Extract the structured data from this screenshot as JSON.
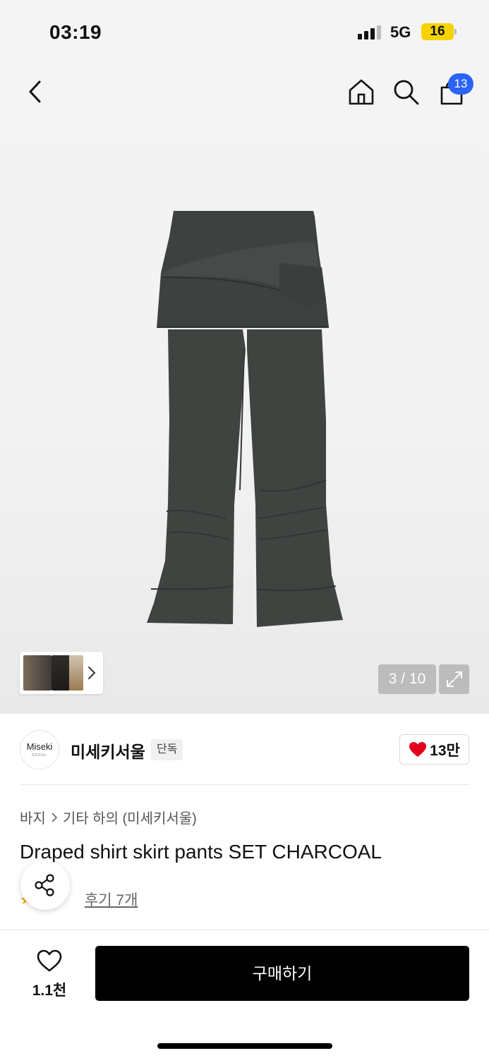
{
  "status_bar": {
    "time": "03:19",
    "network": "5G",
    "battery": "16"
  },
  "nav": {
    "cart_count": "13"
  },
  "gallery": {
    "counter": "3 / 10"
  },
  "brand": {
    "logo_text": "Miseki",
    "logo_subtext": "SEOUL",
    "name": "미세키서울",
    "tag": "단독",
    "likes": "13만"
  },
  "product": {
    "breadcrumb": [
      "바지",
      "기타 하의 (미세키서울)"
    ],
    "title": "Draped shirt skirt pants SET CHARCOAL",
    "reviews_link": "후기 7개"
  },
  "bottom_bar": {
    "wish_count": "1.1천",
    "buy_label": "구매하기"
  },
  "colors": {
    "accent_blue": "#2a63f5",
    "heart_red": "#e3001b",
    "rating_star": "#f0a800",
    "product_charcoal": "#3f4441"
  },
  "icons": [
    "back-icon",
    "home-icon",
    "search-icon",
    "bag-icon",
    "chevron-right-icon",
    "expand-icon",
    "heart-icon",
    "share-icon",
    "star-icon"
  ]
}
